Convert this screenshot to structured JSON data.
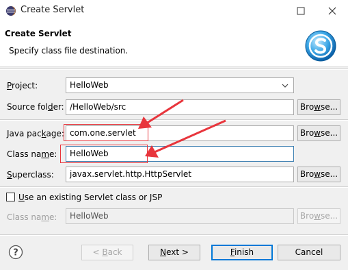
{
  "window": {
    "title": "Create Servlet"
  },
  "header": {
    "title": "Create Servlet",
    "description": "Specify class file destination."
  },
  "form": {
    "project": {
      "label_pre": "",
      "label_u": "P",
      "label_post": "roject:",
      "value": "HelloWeb"
    },
    "source_folder": {
      "label": "Source fol",
      "label_u": "d",
      "label_post": "er:",
      "value": "/HelloWeb/src"
    },
    "java_package": {
      "label": "Java pac",
      "label_u": "k",
      "label_post": "age:",
      "value": "com.one.servlet"
    },
    "class_name": {
      "label": "Class na",
      "label_u": "m",
      "label_post": "e:",
      "value": "HelloWeb"
    },
    "superclass": {
      "label_u": "S",
      "label_post": "uperclass:",
      "value": "javax.servlet.http.HttpServlet"
    },
    "use_existing": {
      "label_u": "U",
      "label_post": "se an existing Servlet class or JSP",
      "checked": false
    },
    "existing_class_name": {
      "label": "Class na",
      "label_u": "m",
      "label_post": "e:",
      "value": "HelloWeb"
    }
  },
  "browse": {
    "label_pre": "Bro",
    "label_u": "w",
    "label_post": "se..."
  },
  "footer": {
    "back": {
      "pre": "< ",
      "u": "B",
      "post": "ack"
    },
    "next": {
      "u": "N",
      "post": "ext >"
    },
    "finish": {
      "u": "F",
      "post": "inish"
    },
    "cancel": "Cancel"
  },
  "colors": {
    "annotation_red": "#e8353c",
    "focus_blue": "#0078d7"
  }
}
